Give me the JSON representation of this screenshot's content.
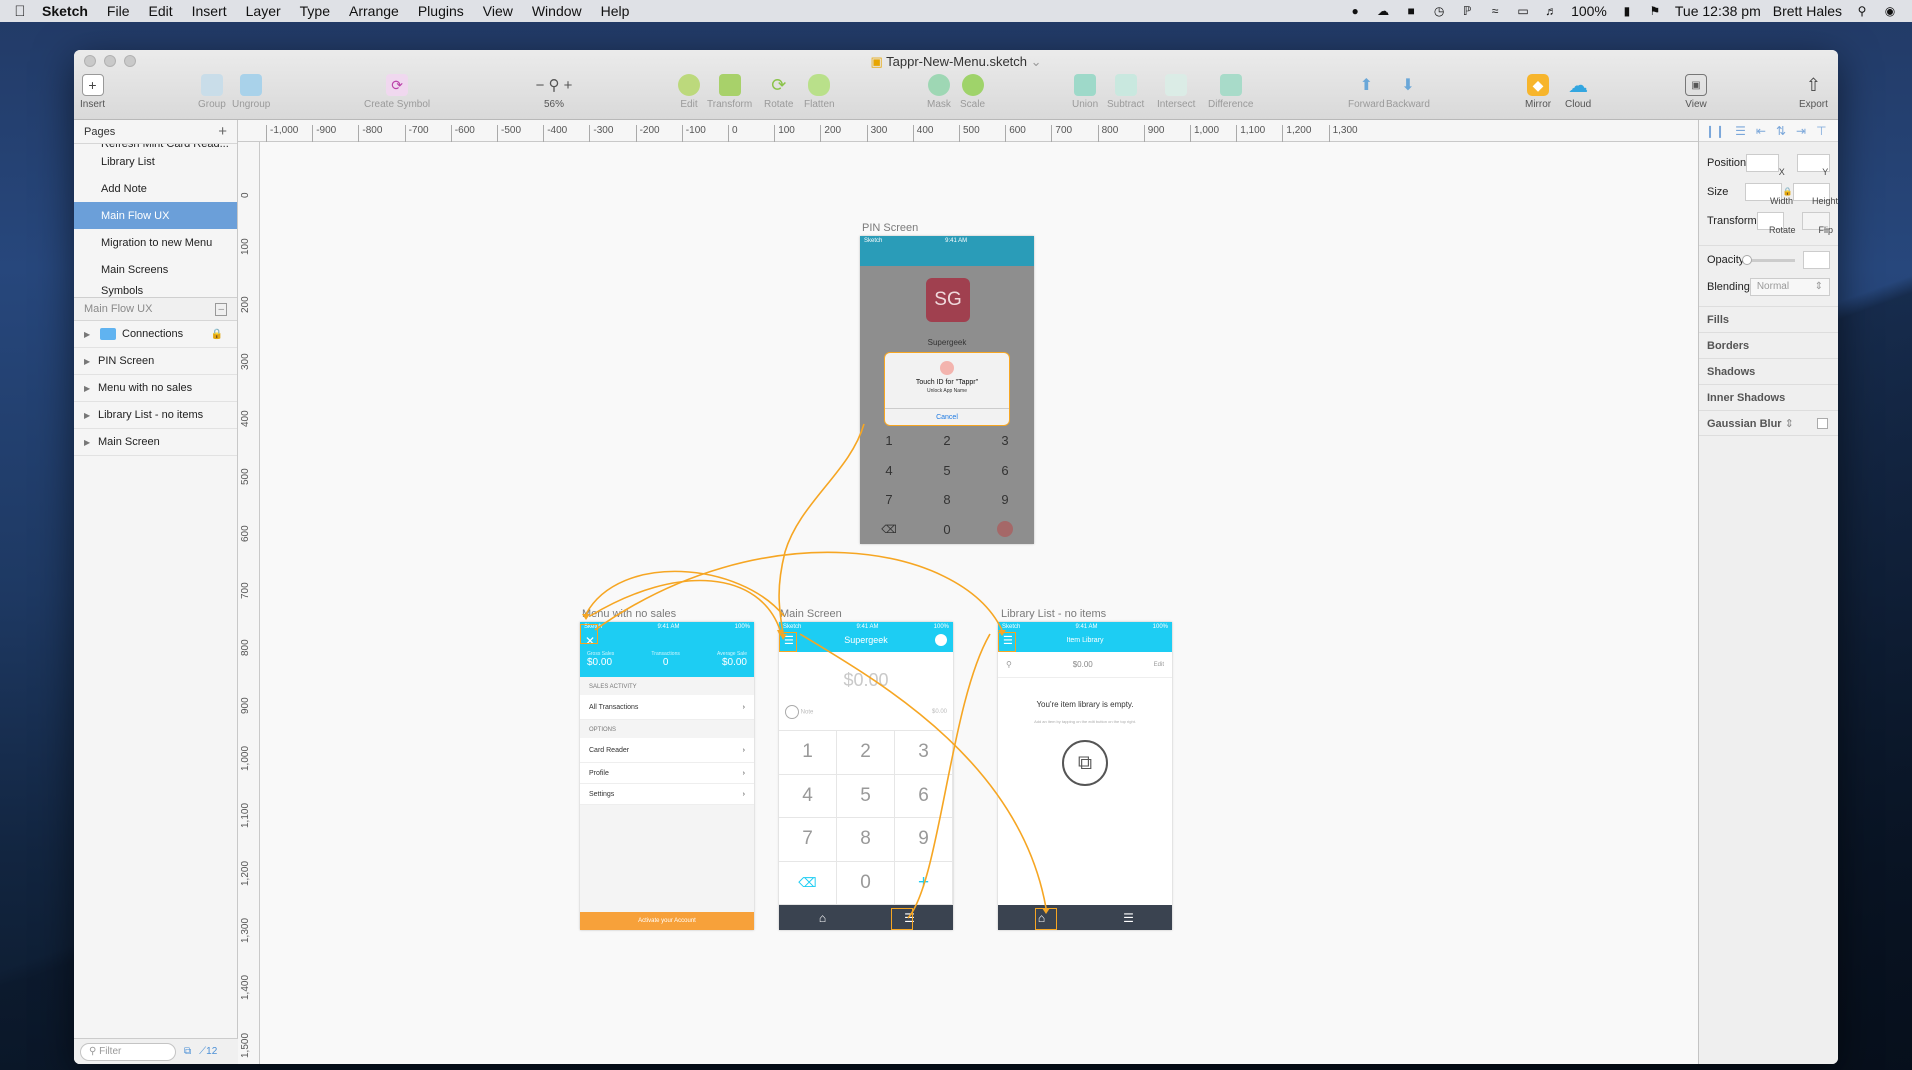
{
  "menubar": {
    "apple_icon": "apple-icon",
    "app_name": "Sketch",
    "menus": [
      "File",
      "Edit",
      "Insert",
      "Layer",
      "Type",
      "Arrange",
      "Plugins",
      "View",
      "Window",
      "Help"
    ],
    "battery": "100%",
    "clock": "Tue 12:38 pm",
    "user": "Brett Hales"
  },
  "window": {
    "title": "Tappr-New-Menu.sketch"
  },
  "toolbar": {
    "insert": "Insert",
    "group": "Group",
    "ungroup": "Ungroup",
    "create_symbol": "Create Symbol",
    "zoom": "56%",
    "edit": "Edit",
    "transform": "Transform",
    "rotate": "Rotate",
    "flatten": "Flatten",
    "mask": "Mask",
    "scale": "Scale",
    "union": "Union",
    "subtract": "Subtract",
    "intersect": "Intersect",
    "difference": "Difference",
    "forward": "Forward",
    "backward": "Backward",
    "mirror": "Mirror",
    "cloud": "Cloud",
    "view": "View",
    "export": "Export"
  },
  "pages": {
    "header": "Pages",
    "truncated_item": "Refresh Mint Card Read...",
    "items": [
      "Library List",
      "Add Note",
      "Main Flow UX",
      "Migration to new Menu",
      "Main Screens",
      "Symbols"
    ],
    "selected": "Main Flow UX"
  },
  "layers": {
    "header": "Main Flow UX",
    "items": [
      "Connections",
      "PIN Screen",
      "Menu with no sales",
      "Library List - no items",
      "Main Screen"
    ]
  },
  "filter": {
    "placeholder": "Filter",
    "count": "12"
  },
  "rulers": {
    "h": [
      "-1,000",
      "-900",
      "-800",
      "-700",
      "-600",
      "-500",
      "-400",
      "-300",
      "-200",
      "-100",
      "0",
      "100",
      "200",
      "300",
      "400",
      "500",
      "600",
      "700",
      "800",
      "900",
      "1,000",
      "1,100",
      "1,200",
      "1,300"
    ],
    "v": [
      "0",
      "100",
      "200",
      "300",
      "400",
      "500",
      "600",
      "700",
      "800",
      "900",
      "1,000",
      "1,100",
      "1,200",
      "1,300",
      "1,400",
      "1,500"
    ]
  },
  "inspector": {
    "position": "Position",
    "x": "X",
    "y": "Y",
    "size": "Size",
    "width": "Width",
    "height": "Height",
    "transform": "Transform",
    "rotate": "Rotate",
    "flip": "Flip",
    "opacity": "Opacity",
    "blending": "Blending",
    "blending_value": "Normal",
    "fills": "Fills",
    "borders": "Borders",
    "shadows": "Shadows",
    "inner_shadows": "Inner Shadows",
    "gaussian_blur": "Gaussian Blur"
  },
  "artboards": {
    "pin": {
      "label": "PIN Screen",
      "status_left": "Sketch",
      "status_time": "9:41 AM",
      "avatar": "SG",
      "name": "Supergeek",
      "dialog_title": "Touch ID for \"Tappr\"",
      "dialog_sub": "Unlock App Name",
      "cancel": "Cancel",
      "keys": [
        "1",
        "2",
        "3",
        "4",
        "5",
        "6",
        "7",
        "8",
        "9",
        "⌫",
        "0",
        ""
      ]
    },
    "menu": {
      "label": "Menu with no sales",
      "status_left": "Sketch",
      "status_time": "9:41 AM",
      "status_right": "100%",
      "stat1_label": "Gross Sales",
      "stat1_value": "$0.00",
      "stat2_label": "Transactions",
      "stat2_value": "0",
      "stat3_label": "Average Sale",
      "stat3_value": "$0.00",
      "sales_activity": "SALES ACTIVITY",
      "all_transactions": "All Transactions",
      "options": "OPTIONS",
      "card_reader": "Card Reader",
      "profile": "Profile",
      "settings": "Settings",
      "activate": "Activate your Account"
    },
    "main": {
      "label": "Main Screen",
      "status_left": "Sketch",
      "status_time": "9:41 AM",
      "status_right": "100%",
      "title": "Supergeek",
      "amount": "$0.00",
      "note": "Note",
      "note_amount": "$0.00",
      "keys": [
        "1",
        "2",
        "3",
        "4",
        "5",
        "6",
        "7",
        "8",
        "9",
        "⌫",
        "0",
        "+"
      ]
    },
    "library": {
      "label": "Library List - no items",
      "status_left": "Sketch",
      "status_time": "9:41 AM",
      "status_right": "100%",
      "title": "Item Library",
      "amount": "$0.00",
      "edit": "Edit",
      "empty": "You're item library is empty.",
      "hint": "Add an item by tapping on the edit button on the top right."
    }
  },
  "colors": {
    "accent": "#1dcdf3",
    "selection": "#6b9fd9",
    "prototype_link": "#f6a623",
    "activate": "#f7a13a"
  }
}
